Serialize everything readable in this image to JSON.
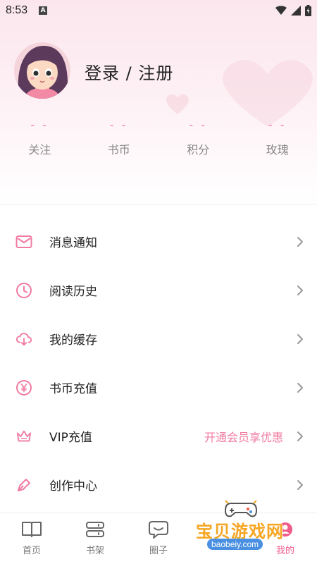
{
  "status_bar": {
    "time": "8:53",
    "notif_icon_text": "A"
  },
  "profile": {
    "login_label": "登录 / 注册"
  },
  "stats": [
    {
      "value": "- -",
      "label": "关注"
    },
    {
      "value": "- -",
      "label": "书币"
    },
    {
      "value": "- -",
      "label": "积分"
    },
    {
      "value": "- -",
      "label": "玫瑰"
    }
  ],
  "menu": [
    {
      "label": "消息通知",
      "icon": "mail-icon"
    },
    {
      "label": "阅读历史",
      "icon": "clock-icon"
    },
    {
      "label": "我的缓存",
      "icon": "cloud-download-icon"
    },
    {
      "label": "书币充值",
      "icon": "yen-coin-icon"
    },
    {
      "label": "VIP充值",
      "icon": "crown-icon",
      "extra": "开通会员享优惠"
    },
    {
      "label": "创作中心",
      "icon": "pen-icon"
    }
  ],
  "bottom_nav": [
    {
      "label": "首页",
      "icon": "book-open-icon",
      "active": false
    },
    {
      "label": "书架",
      "icon": "bookshelf-icon",
      "active": false
    },
    {
      "label": "圈子",
      "icon": "chat-bubble-icon",
      "active": false
    },
    {
      "label": "",
      "icon": "unknown-icon",
      "active": false
    },
    {
      "label": "我的",
      "icon": "user-icon",
      "active": true
    }
  ],
  "watermark": {
    "text": "宝贝游戏网",
    "url": "baobeiy.com"
  },
  "colors": {
    "accent": "#f05c8a",
    "pink_light": "#fbe6ee",
    "watermark_orange": "#f5a623"
  }
}
